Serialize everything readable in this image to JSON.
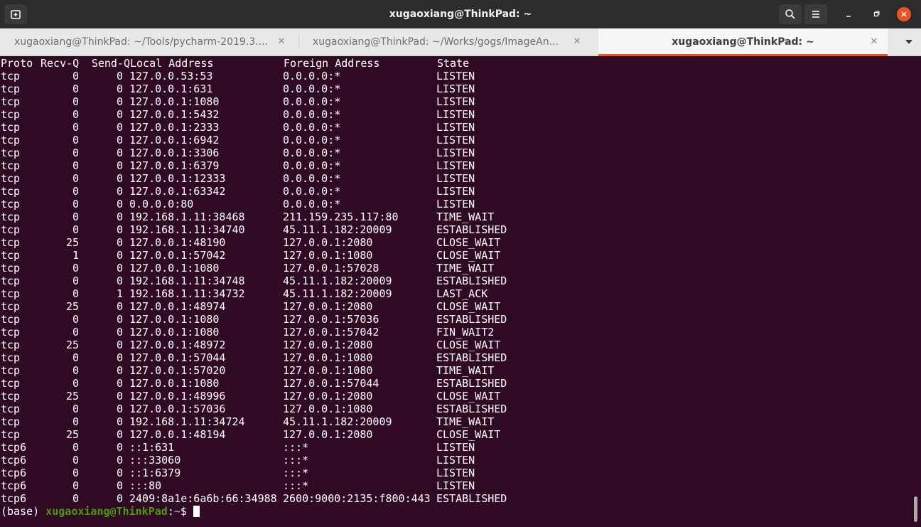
{
  "window": {
    "title": "xugaoxiang@ThinkPad: ~",
    "colors": {
      "titlebar": "#2c2c2c",
      "terminal_bg": "#300a24",
      "accent": "#e95420"
    },
    "icons": [
      "new-tab-icon",
      "search-icon",
      "hamburger-menu-icon",
      "minimize-icon",
      "maximize-icon",
      "close-icon"
    ]
  },
  "tabs": [
    {
      "label": "xugaoxiang@ThinkPad: ~/Tools/pycharm-2019.3....",
      "active": false
    },
    {
      "label": "xugaoxiang@ThinkPad: ~/Works/gogs/ImageAn...",
      "active": false
    },
    {
      "label": "xugaoxiang@ThinkPad: ~",
      "active": true
    }
  ],
  "terminal": {
    "header": {
      "proto": "Proto",
      "recvq": "Recv-Q",
      "sendq": "Send-Q",
      "local": "Local Address",
      "foreign": "Foreign Address",
      "state": "State"
    },
    "rows": [
      {
        "proto": "tcp",
        "recvq": "0",
        "sendq": "0",
        "local": "127.0.0.53:53",
        "foreign": "0.0.0.0:*",
        "state": "LISTEN"
      },
      {
        "proto": "tcp",
        "recvq": "0",
        "sendq": "0",
        "local": "127.0.0.1:631",
        "foreign": "0.0.0.0:*",
        "state": "LISTEN"
      },
      {
        "proto": "tcp",
        "recvq": "0",
        "sendq": "0",
        "local": "127.0.0.1:1080",
        "foreign": "0.0.0.0:*",
        "state": "LISTEN"
      },
      {
        "proto": "tcp",
        "recvq": "0",
        "sendq": "0",
        "local": "127.0.0.1:5432",
        "foreign": "0.0.0.0:*",
        "state": "LISTEN"
      },
      {
        "proto": "tcp",
        "recvq": "0",
        "sendq": "0",
        "local": "127.0.0.1:2333",
        "foreign": "0.0.0.0:*",
        "state": "LISTEN"
      },
      {
        "proto": "tcp",
        "recvq": "0",
        "sendq": "0",
        "local": "127.0.0.1:6942",
        "foreign": "0.0.0.0:*",
        "state": "LISTEN"
      },
      {
        "proto": "tcp",
        "recvq": "0",
        "sendq": "0",
        "local": "127.0.0.1:3306",
        "foreign": "0.0.0.0:*",
        "state": "LISTEN"
      },
      {
        "proto": "tcp",
        "recvq": "0",
        "sendq": "0",
        "local": "127.0.0.1:6379",
        "foreign": "0.0.0.0:*",
        "state": "LISTEN"
      },
      {
        "proto": "tcp",
        "recvq": "0",
        "sendq": "0",
        "local": "127.0.0.1:12333",
        "foreign": "0.0.0.0:*",
        "state": "LISTEN"
      },
      {
        "proto": "tcp",
        "recvq": "0",
        "sendq": "0",
        "local": "127.0.0.1:63342",
        "foreign": "0.0.0.0:*",
        "state": "LISTEN"
      },
      {
        "proto": "tcp",
        "recvq": "0",
        "sendq": "0",
        "local": "0.0.0.0:80",
        "foreign": "0.0.0.0:*",
        "state": "LISTEN"
      },
      {
        "proto": "tcp",
        "recvq": "0",
        "sendq": "0",
        "local": "192.168.1.11:38468",
        "foreign": "211.159.235.117:80",
        "state": "TIME_WAIT"
      },
      {
        "proto": "tcp",
        "recvq": "0",
        "sendq": "0",
        "local": "192.168.1.11:34740",
        "foreign": "45.11.1.182:20009",
        "state": "ESTABLISHED"
      },
      {
        "proto": "tcp",
        "recvq": "25",
        "sendq": "0",
        "local": "127.0.0.1:48190",
        "foreign": "127.0.0.1:2080",
        "state": "CLOSE_WAIT"
      },
      {
        "proto": "tcp",
        "recvq": "1",
        "sendq": "0",
        "local": "127.0.0.1:57042",
        "foreign": "127.0.0.1:1080",
        "state": "CLOSE_WAIT"
      },
      {
        "proto": "tcp",
        "recvq": "0",
        "sendq": "0",
        "local": "127.0.0.1:1080",
        "foreign": "127.0.0.1:57028",
        "state": "TIME_WAIT"
      },
      {
        "proto": "tcp",
        "recvq": "0",
        "sendq": "0",
        "local": "192.168.1.11:34748",
        "foreign": "45.11.1.182:20009",
        "state": "ESTABLISHED"
      },
      {
        "proto": "tcp",
        "recvq": "0",
        "sendq": "1",
        "local": "192.168.1.11:34732",
        "foreign": "45.11.1.182:20009",
        "state": "LAST_ACK"
      },
      {
        "proto": "tcp",
        "recvq": "25",
        "sendq": "0",
        "local": "127.0.0.1:48974",
        "foreign": "127.0.0.1:2080",
        "state": "CLOSE_WAIT"
      },
      {
        "proto": "tcp",
        "recvq": "0",
        "sendq": "0",
        "local": "127.0.0.1:1080",
        "foreign": "127.0.0.1:57036",
        "state": "ESTABLISHED"
      },
      {
        "proto": "tcp",
        "recvq": "0",
        "sendq": "0",
        "local": "127.0.0.1:1080",
        "foreign": "127.0.0.1:57042",
        "state": "FIN_WAIT2"
      },
      {
        "proto": "tcp",
        "recvq": "25",
        "sendq": "0",
        "local": "127.0.0.1:48972",
        "foreign": "127.0.0.1:2080",
        "state": "CLOSE_WAIT"
      },
      {
        "proto": "tcp",
        "recvq": "0",
        "sendq": "0",
        "local": "127.0.0.1:57044",
        "foreign": "127.0.0.1:1080",
        "state": "ESTABLISHED"
      },
      {
        "proto": "tcp",
        "recvq": "0",
        "sendq": "0",
        "local": "127.0.0.1:57020",
        "foreign": "127.0.0.1:1080",
        "state": "TIME_WAIT"
      },
      {
        "proto": "tcp",
        "recvq": "0",
        "sendq": "0",
        "local": "127.0.0.1:1080",
        "foreign": "127.0.0.1:57044",
        "state": "ESTABLISHED"
      },
      {
        "proto": "tcp",
        "recvq": "25",
        "sendq": "0",
        "local": "127.0.0.1:48996",
        "foreign": "127.0.0.1:2080",
        "state": "CLOSE_WAIT"
      },
      {
        "proto": "tcp",
        "recvq": "0",
        "sendq": "0",
        "local": "127.0.0.1:57036",
        "foreign": "127.0.0.1:1080",
        "state": "ESTABLISHED"
      },
      {
        "proto": "tcp",
        "recvq": "0",
        "sendq": "0",
        "local": "192.168.1.11:34724",
        "foreign": "45.11.1.182:20009",
        "state": "TIME_WAIT"
      },
      {
        "proto": "tcp",
        "recvq": "25",
        "sendq": "0",
        "local": "127.0.0.1:48194",
        "foreign": "127.0.0.1:2080",
        "state": "CLOSE_WAIT"
      },
      {
        "proto": "tcp6",
        "recvq": "0",
        "sendq": "0",
        "local": "::1:631",
        "foreign": ":::*",
        "state": "LISTEN"
      },
      {
        "proto": "tcp6",
        "recvq": "0",
        "sendq": "0",
        "local": ":::33060",
        "foreign": ":::*",
        "state": "LISTEN"
      },
      {
        "proto": "tcp6",
        "recvq": "0",
        "sendq": "0",
        "local": "::1:6379",
        "foreign": ":::*",
        "state": "LISTEN"
      },
      {
        "proto": "tcp6",
        "recvq": "0",
        "sendq": "0",
        "local": ":::80",
        "foreign": ":::*",
        "state": "LISTEN"
      },
      {
        "proto": "tcp6",
        "recvq": "0",
        "sendq": "0",
        "local": "2409:8a1e:6a6b:66:34988",
        "foreign": "2600:9000:2135:f800:443",
        "state": "ESTABLISHED"
      }
    ],
    "prompt": {
      "env": "(base) ",
      "user_host": "xugaoxiang@ThinkPad",
      "sep": ":",
      "path": "~",
      "symbol": "$"
    }
  }
}
